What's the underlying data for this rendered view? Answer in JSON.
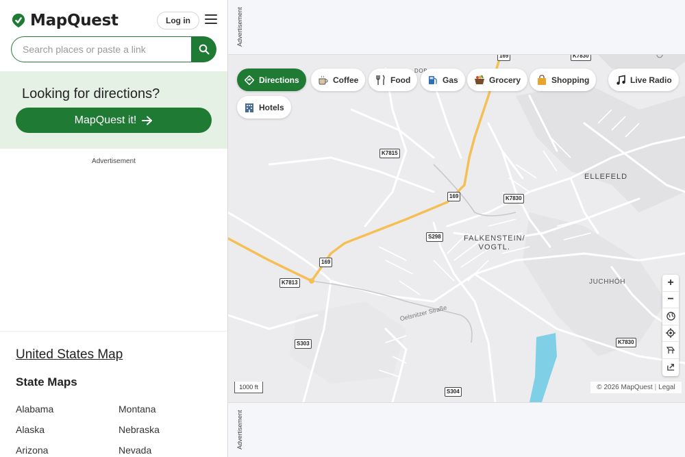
{
  "header": {
    "logo_text": "MapQuest",
    "login_label": "Log in"
  },
  "search": {
    "placeholder": "Search places or paste a link"
  },
  "directions": {
    "title": "Looking for directions?",
    "button_label": "MapQuest it!"
  },
  "ads": {
    "label": "Advertisement"
  },
  "states": {
    "us_map_link": "United States Map",
    "title": "State Maps",
    "column1": [
      "Alabama",
      "Alaska",
      "Arizona"
    ],
    "column2": [
      "Montana",
      "Nebraska",
      "Nevada"
    ]
  },
  "categories": [
    {
      "label": "Directions",
      "icon": "directions-icon",
      "active": true
    },
    {
      "label": "Coffee",
      "icon": "coffee-icon"
    },
    {
      "label": "Food",
      "icon": "food-icon"
    },
    {
      "label": "Gas",
      "icon": "gas-icon"
    },
    {
      "label": "Grocery",
      "icon": "grocery-icon"
    },
    {
      "label": "Shopping",
      "icon": "shopping-icon"
    },
    {
      "label": "Live Radio",
      "icon": "radio-icon"
    },
    {
      "label": "Hotels",
      "icon": "hotel-icon"
    }
  ],
  "map": {
    "places": {
      "ellefeld": "ELLEFELD",
      "falkenstein": "FALKENSTEIN/\nVOGTL.",
      "juchhoh": "JUCHHÖH",
      "dob": "DOB"
    },
    "road_label": "Oelsnitzer Straße",
    "shields": [
      "169",
      "K7830",
      "K7815",
      "169",
      "K7830",
      "S298",
      "169",
      "K7813",
      "S303",
      "K7830",
      "S304"
    ],
    "scale_label": "1000 ft",
    "attribution": "© 2026 MapQuest",
    "legal_label": "Legal"
  },
  "colors": {
    "brand_green": "#1f7a34",
    "highway": "#f7c35c",
    "water": "#7fd0e6"
  }
}
